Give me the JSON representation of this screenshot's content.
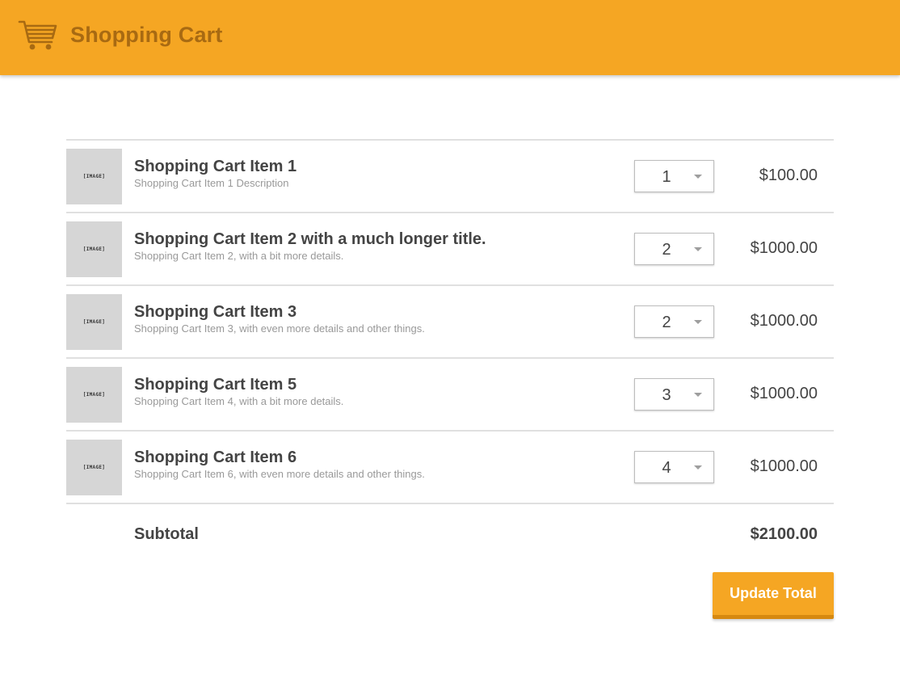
{
  "header": {
    "title": "Shopping Cart",
    "icon": "shopping-cart-icon",
    "background_color": "#f5a623",
    "title_color": "#a86a12"
  },
  "cart": {
    "image_placeholder": "[IMAGE]",
    "items": [
      {
        "title": "Shopping Cart Item 1",
        "description": "Shopping Cart Item 1 Description",
        "quantity": "1",
        "price": "$100.00"
      },
      {
        "title": "Shopping Cart Item 2 with a much longer title.",
        "description": "Shopping Cart Item 2, with a bit more details.",
        "quantity": "2",
        "price": "$1000.00"
      },
      {
        "title": "Shopping Cart Item 3",
        "description": "Shopping Cart Item 3, with even more details and other things.",
        "quantity": "2",
        "price": "$1000.00"
      },
      {
        "title": "Shopping Cart Item 5",
        "description": "Shopping Cart Item 4, with a bit more details.",
        "quantity": "3",
        "price": "$1000.00"
      },
      {
        "title": "Shopping Cart Item 6",
        "description": "Shopping Cart Item 6, with even more details and other things.",
        "quantity": "4",
        "price": "$1000.00"
      }
    ],
    "subtotal_label": "Subtotal",
    "subtotal_value": "$2100.00"
  },
  "actions": {
    "update_label": "Update Total",
    "accent_color": "#f5a623"
  }
}
